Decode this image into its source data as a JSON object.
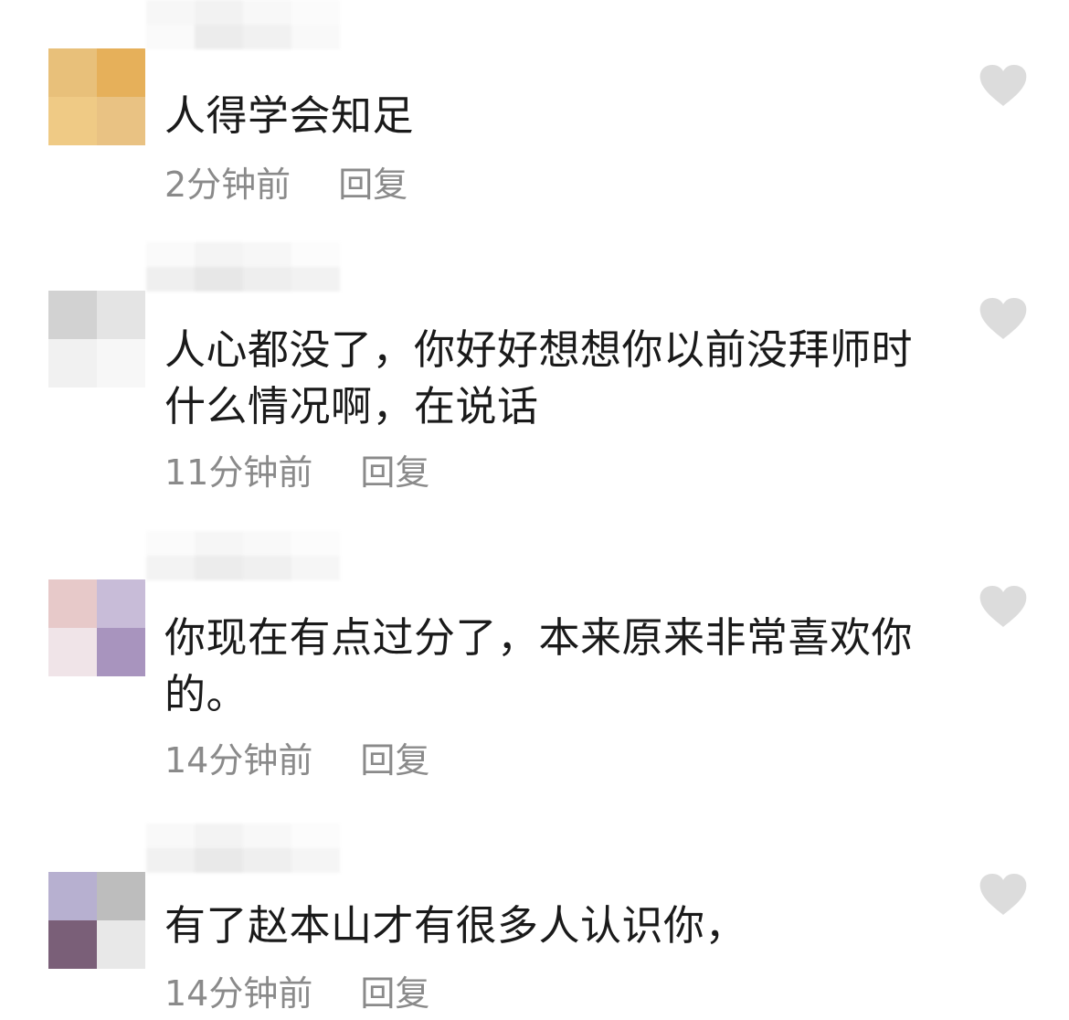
{
  "colors": {
    "text": "#1a1a1a",
    "meta": "#8a8a8a",
    "like_icon": "#dcdcdc"
  },
  "comments": [
    {
      "text": "人得学会知足",
      "time": "2分钟前",
      "reply_label": "回复",
      "like_icon": "heart-icon",
      "avatar_colors": [
        "#e8c07a",
        "#e6b05a",
        "#efca85",
        "#e9c283"
      ]
    },
    {
      "text": "人心都没了，你好好想想你以前没拜师时什么情况啊，在说话",
      "time": "11分钟前",
      "reply_label": "回复",
      "like_icon": "heart-icon",
      "avatar_colors": [
        "#d2d2d2",
        "#e4e4e4",
        "#f1f1f1",
        "#f7f7f7"
      ]
    },
    {
      "text": "你现在有点过分了，本来原来非常喜欢你的。",
      "time": "14分钟前",
      "reply_label": "回复",
      "like_icon": "heart-icon",
      "avatar_colors": [
        "#e7c9c9",
        "#c8bcd8",
        "#f0e4e8",
        "#a894be"
      ]
    },
    {
      "text": "有了赵本山才有很多人认识你，",
      "time": "14分钟前",
      "reply_label": "回复",
      "like_icon": "heart-icon",
      "avatar_colors": [
        "#b7b0d0",
        "#bdbdbd",
        "#7a5f78",
        "#e8e8e8"
      ]
    }
  ]
}
